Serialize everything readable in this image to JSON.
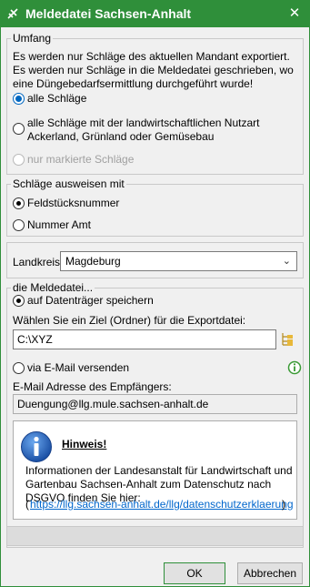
{
  "window": {
    "title": "Meldedatei Sachsen-Anhalt",
    "close_label": "✕"
  },
  "umfang": {
    "legend": "Umfang",
    "description": "Es werden nur Schläge des aktuellen Mandant exportiert. Es werden nur Schläge in die Meldedatei geschrieben, wo eine Düngebedarfsermittlung durchgeführt wurde!",
    "options": [
      {
        "label": "alle Schläge",
        "selected": true
      },
      {
        "label": "alle Schläge mit der landwirtschaftlichen Nutzart Ackerland, Grünland oder Gemüsebau",
        "selected": false
      },
      {
        "label": "nur markierte Schläge",
        "selected": false,
        "disabled": true
      }
    ]
  },
  "schlaege_ausweisen": {
    "legend": "Schläge ausweisen mit",
    "options": [
      {
        "label": "Feldstücksnummer",
        "selected": true
      },
      {
        "label": "Nummer Amt",
        "selected": false
      }
    ]
  },
  "landkreis": {
    "label": "Landkreis:",
    "value": "Magdeburg"
  },
  "meldedatei": {
    "legend": "die Meldedatei...",
    "option_save": "auf Datenträger speichern",
    "target_label": "Wählen Sie ein Ziel (Ordner) für die Exportdatei:",
    "target_value": "C:\\XYZ",
    "option_email": "via E-Mail versenden",
    "email_label": "E-Mail Adresse des Empfängers:",
    "email_value": "Duengung@llg.mule.sachsen-anhalt.de"
  },
  "hinweis": {
    "title": "Hinweis!",
    "text": "Informationen der Landesanstalt für Landwirtschaft und Gartenbau Sachsen-Anhalt zum Datenschutz nach DSGVO finden Sie hier:",
    "link_text": "https://llg.sachsen-anhalt.de/llg/datenschutzerklaerung"
  },
  "buttons": {
    "ok": "OK",
    "cancel": "Abbrechen"
  },
  "colors": {
    "titlebar": "#2f8f3a",
    "link": "#0066cc",
    "info_icon": "#1a5fb4"
  }
}
